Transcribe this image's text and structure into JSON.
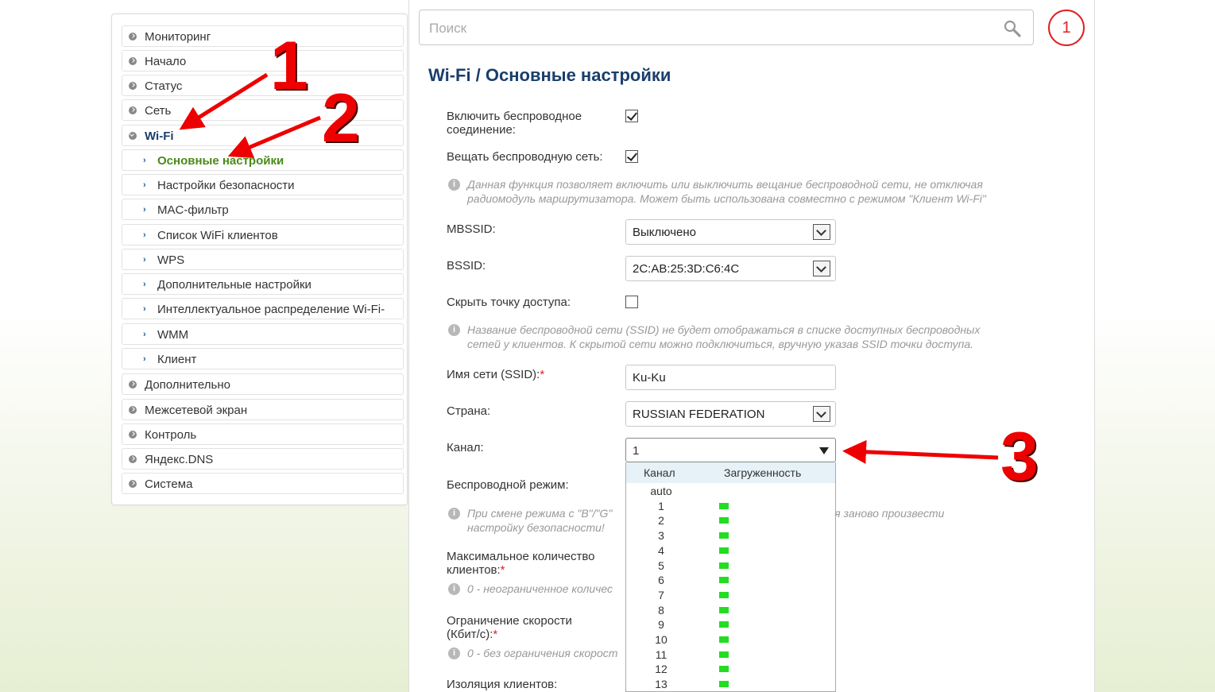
{
  "sidebar": {
    "items": [
      {
        "label": "Мониторинг"
      },
      {
        "label": "Начало"
      },
      {
        "label": "Статус"
      },
      {
        "label": "Сеть"
      },
      {
        "label": "Wi-Fi"
      },
      {
        "label": "Основные настройки"
      },
      {
        "label": "Настройки безопасности"
      },
      {
        "label": "MAC-фильтр"
      },
      {
        "label": "Список WiFi клиентов"
      },
      {
        "label": "WPS"
      },
      {
        "label": "Дополнительные настройки"
      },
      {
        "label": "Интеллектуальное распределение Wi-Fi-"
      },
      {
        "label": "WMM"
      },
      {
        "label": "Клиент"
      },
      {
        "label": "Дополнительно"
      },
      {
        "label": "Межсетевой экран"
      },
      {
        "label": "Контроль"
      },
      {
        "label": "Яндекс.DNS"
      },
      {
        "label": "Система"
      }
    ]
  },
  "search": {
    "placeholder": "Поиск",
    "value": ""
  },
  "notifications": {
    "count": "1"
  },
  "page": {
    "title": "Wi-Fi /  Основные настройки"
  },
  "form": {
    "enable_wireless": {
      "label_1": "Включить беспроводное",
      "label_2": "соединение:",
      "checked": true
    },
    "broadcast": {
      "label": "Вещать беспроводную сеть:",
      "checked": true
    },
    "broadcast_hint": {
      "line1": "Данная функция позволяет включить или выключить вещание беспроводной сети, не отключая",
      "line2": "радиомодуль маршрутизатора. Может быть использована совместно с режимом \"Клиент Wi-Fi\""
    },
    "mbssid": {
      "label": "MBSSID:",
      "value": "Выключено"
    },
    "bssid": {
      "label": "BSSID:",
      "value": "2C:AB:25:3D:C6:4C"
    },
    "hide_ap": {
      "label": "Скрыть точку доступа:",
      "checked": false
    },
    "hide_hint": {
      "line1": "Название беспроводной сети (SSID) не будет отображаться в списке доступных беспроводных",
      "line2": "сетей у клиентов. К скрытой сети можно подключиться, вручную указав SSID точки доступа."
    },
    "ssid": {
      "label": "Имя сети (SSID):",
      "required": "*",
      "value": "Ku-Ku"
    },
    "country": {
      "label": "Страна:",
      "value": "RUSSIAN FEDERATION"
    },
    "channel": {
      "label": "Канал:",
      "value": "1"
    },
    "wireless_mode": {
      "label": "Беспроводной режим:"
    },
    "mode_hint": {
      "line1_a": "При смене режима с \"B\"/\"G\"",
      "line1_b": "ется заново произвести",
      "line2": "настройку безопасности!"
    },
    "max_clients": {
      "label_1": "Максимальное количество",
      "label_2": "клиентов:",
      "required": "*",
      "hint": "0 - неограниченное количес"
    },
    "speed_limit": {
      "label_1": "Ограничение скорости",
      "label_2": "(Кбит/с):",
      "required": "*",
      "hint": "0 - без ограничения скорост"
    },
    "isolation": {
      "label": "Изоляция клиентов:"
    }
  },
  "channel_dropdown": {
    "header_channel": "Канал",
    "header_load": "Загруженность",
    "load_color": "#22dd22",
    "options": [
      "auto",
      "1",
      "2",
      "3",
      "4",
      "5",
      "6",
      "7",
      "8",
      "9",
      "10",
      "11",
      "12",
      "13"
    ]
  },
  "annotations": {
    "n1": "1",
    "n2": "2",
    "n3": "3",
    "color": "#ee0000"
  }
}
